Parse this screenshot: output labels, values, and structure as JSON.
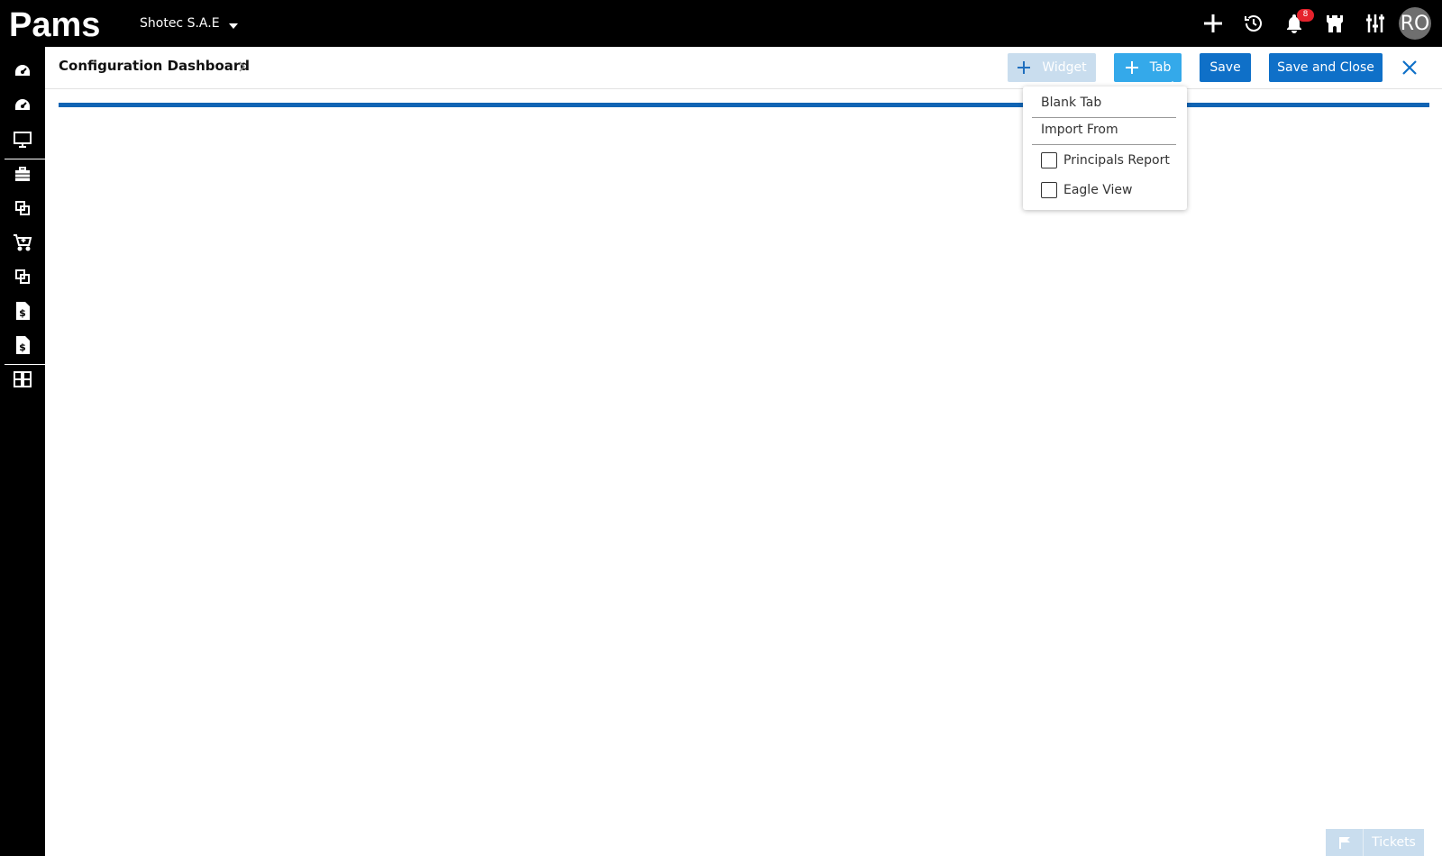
{
  "app": {
    "logo_text": "Pams"
  },
  "topbar": {
    "company": "Shotec S.A.E",
    "notification_count": "8",
    "avatar_initials": "RO"
  },
  "page": {
    "title": "Configuration Dashboard"
  },
  "toolbar": {
    "widget_label": "Widget",
    "tab_label": "Tab",
    "save_label": "Save",
    "save_close_label": "Save and Close"
  },
  "tab_menu": {
    "blank_tab": "Blank Tab",
    "import_from": "Import From",
    "options": [
      {
        "label": "Principals Report",
        "checked": false
      },
      {
        "label": "Eagle View",
        "checked": false
      }
    ]
  },
  "tickets": {
    "label": "Tickets"
  },
  "colors": {
    "primary": "#0f70c8",
    "tab_button": "#34a9ea",
    "disabled_button": "#c9ddee",
    "progress": "#1164b4",
    "badge": "#e5222c"
  }
}
